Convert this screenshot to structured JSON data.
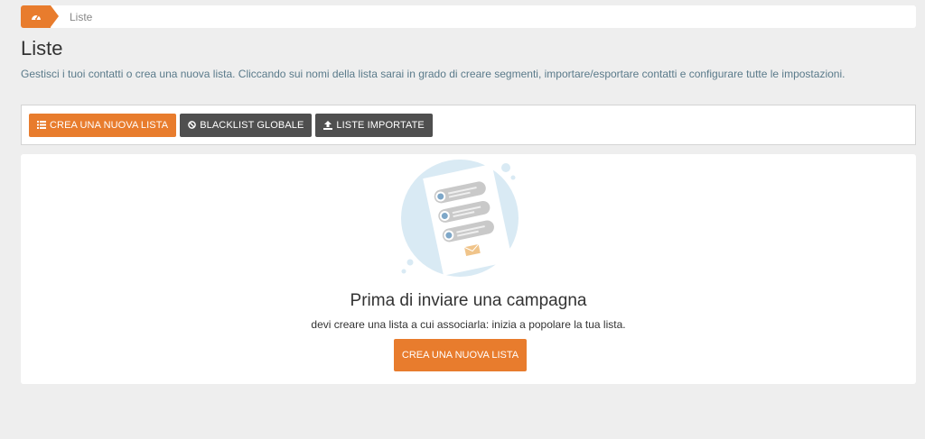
{
  "breadcrumb": {
    "home_icon": "dashboard-icon",
    "current": "Liste"
  },
  "page": {
    "title": "Liste",
    "description": "Gestisci i tuoi contatti o crea una nuova lista. Cliccando sui nomi della lista sarai in grado di creare segmenti, importare/esportare contatti e configurare tutte le impostazioni."
  },
  "toolbar": {
    "create_label": "CREA UNA NUOVA LISTA",
    "create_icon": "list-icon",
    "blacklist_label": "BLACKLIST GLOBALE",
    "blacklist_icon": "ban-icon",
    "imported_label": "LISTE IMPORTATE",
    "imported_icon": "upload-icon"
  },
  "empty_state": {
    "title": "Prima di inviare una campagna",
    "subtitle": "devi creare una lista a cui associarla: inizia a popolare la tua lista.",
    "cta_label": "CREA UNA NUOVA LISTA"
  },
  "colors": {
    "accent": "#e87c2d",
    "dark_button": "#4f4f4f",
    "background": "#eeeeee"
  }
}
